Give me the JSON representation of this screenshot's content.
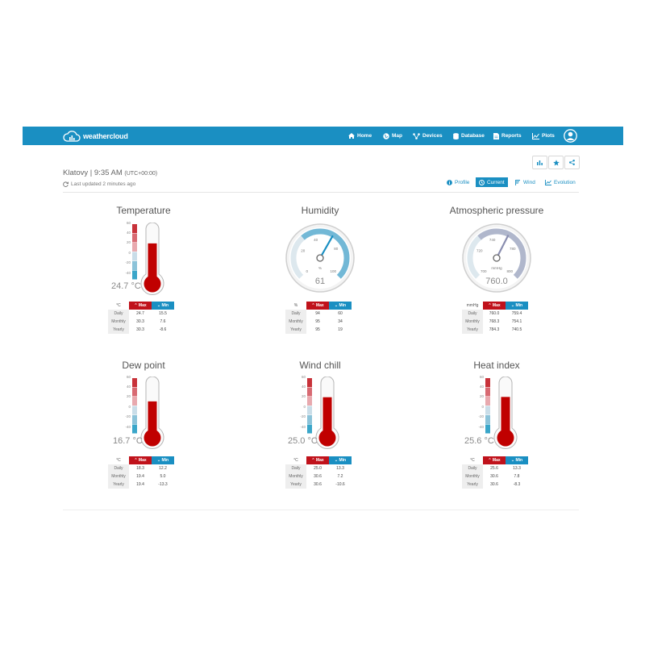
{
  "nav": {
    "logo_text": "weathercloud",
    "items": [
      {
        "label": "Home",
        "icon": "home-icon"
      },
      {
        "label": "Map",
        "icon": "globe-icon"
      },
      {
        "label": "Devices",
        "icon": "devices-icon"
      },
      {
        "label": "Database",
        "icon": "database-icon"
      },
      {
        "label": "Reports",
        "icon": "report-icon"
      },
      {
        "label": "Plots",
        "icon": "chart-icon"
      }
    ]
  },
  "station": {
    "name_time": "Klatovy | 9:35 AM",
    "tz": "(UTC+00:00)",
    "updated": "Last updated 2 minutes ago"
  },
  "tabs": {
    "profile": "Profile",
    "current": "Current",
    "wind": "Wind",
    "evolution": "Evolution"
  },
  "colors": {
    "accent": "#1a8fc2",
    "max": "#c0121b",
    "mercury": "#c00000",
    "gauge": "#1a8fc2",
    "pressure_gauge": "#8a8eb0"
  },
  "table_headers": {
    "max": "Max",
    "min": "Min",
    "daily": "Daily",
    "monthly": "Monthly",
    "yearly": "Yearly"
  },
  "thermo_scale": [
    "60",
    "40",
    "20",
    "0",
    "-20",
    "-40"
  ],
  "humidity_scale": {
    "a": "0",
    "b": "20",
    "c": "40",
    "d": "80",
    "e": "100",
    "unit": "%"
  },
  "pressure_scale": {
    "a": "700",
    "b": "720",
    "c": "740",
    "d": "780",
    "e": "800",
    "unit": "mmHg"
  },
  "panels": {
    "temperature": {
      "title": "Temperature",
      "value": "24.7 °C",
      "level": 24.7,
      "unit": "°C",
      "daily": [
        "24.7",
        "15.5"
      ],
      "monthly": [
        "30.3",
        "7.6"
      ],
      "yearly": [
        "30.3",
        "-8.6"
      ]
    },
    "humidity": {
      "title": "Humidity",
      "value": "61",
      "level": 61,
      "unit": "%",
      "daily": [
        "94",
        "60"
      ],
      "monthly": [
        "95",
        "34"
      ],
      "yearly": [
        "95",
        "19"
      ]
    },
    "pressure": {
      "title": "Atmospheric pressure",
      "value": "760.0",
      "level": 760.0,
      "unit": "mmHg",
      "daily": [
        "760.0",
        "759.4"
      ],
      "monthly": [
        "768.3",
        "754.1"
      ],
      "yearly": [
        "784.3",
        "740.5"
      ]
    },
    "dewpoint": {
      "title": "Dew point",
      "value": "16.7 °C",
      "level": 16.7,
      "unit": "°C",
      "daily": [
        "18.3",
        "12.2"
      ],
      "monthly": [
        "19.4",
        "5.0"
      ],
      "yearly": [
        "19.4",
        "-13.3"
      ]
    },
    "windchill": {
      "title": "Wind chill",
      "value": "25.0 °C",
      "level": 25.0,
      "unit": "°C",
      "daily": [
        "25.0",
        "13.3"
      ],
      "monthly": [
        "30.6",
        "7.2"
      ],
      "yearly": [
        "30.6",
        "-10.6"
      ]
    },
    "heatindex": {
      "title": "Heat index",
      "value": "25.6 °C",
      "level": 25.6,
      "unit": "°C",
      "daily": [
        "25.6",
        "13.3"
      ],
      "monthly": [
        "30.6",
        "7.8"
      ],
      "yearly": [
        "30.6",
        "-8.3"
      ]
    }
  }
}
